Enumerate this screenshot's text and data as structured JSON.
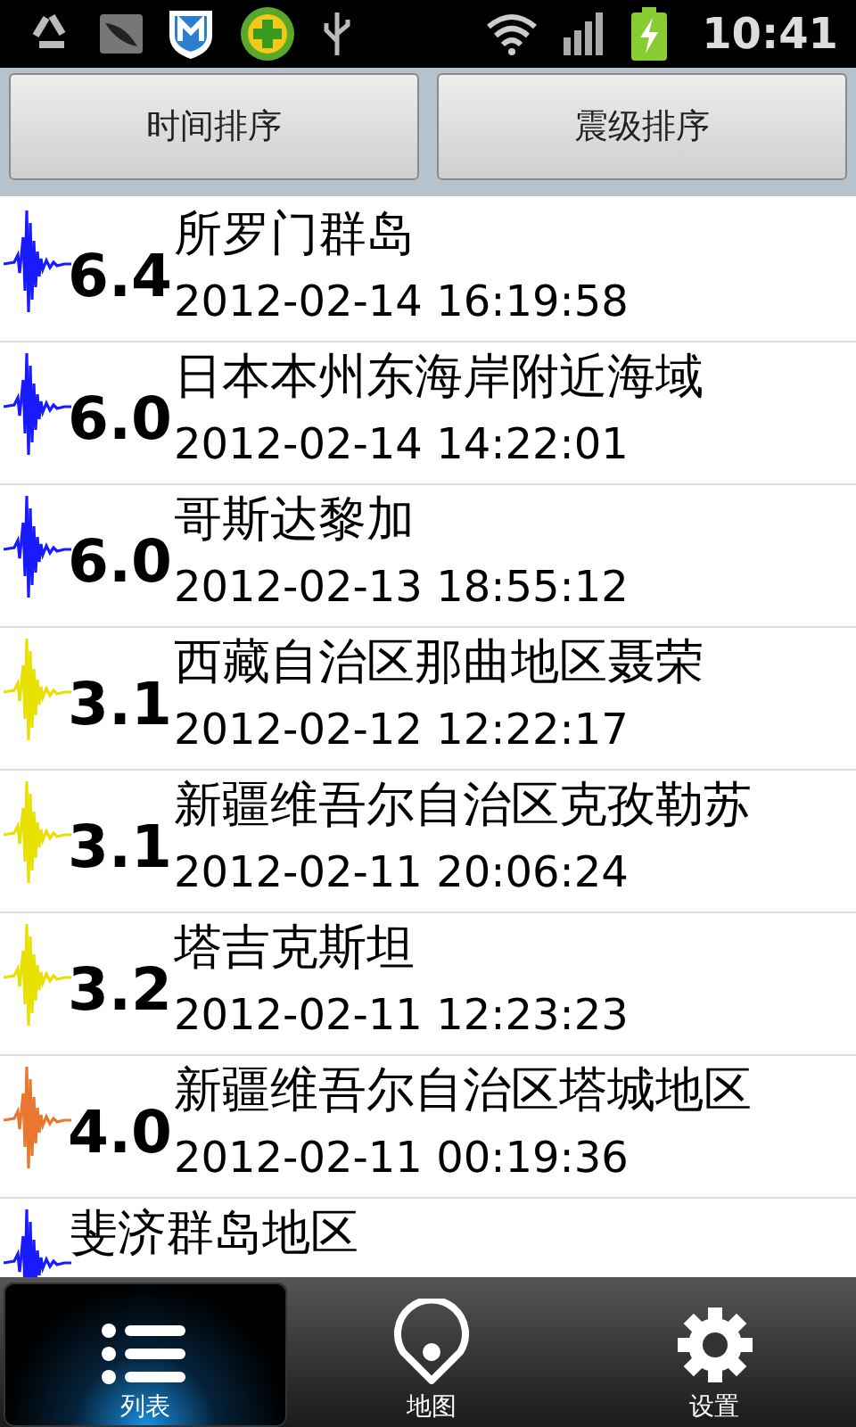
{
  "status_bar": {
    "time": "10:41"
  },
  "sort_buttons": [
    "时间排序",
    "震级排序"
  ],
  "quakes": [
    {
      "magnitude": "6.4",
      "place": "所罗门群岛",
      "time": "2012-02-14 16:19:58",
      "color": "#1a1aff"
    },
    {
      "magnitude": "6.0",
      "place": "日本本州东海岸附近海域",
      "time": "2012-02-14 14:22:01",
      "color": "#1a1aff"
    },
    {
      "magnitude": "6.0",
      "place": "哥斯达黎加",
      "time": "2012-02-13 18:55:12",
      "color": "#1a1aff"
    },
    {
      "magnitude": "3.1",
      "place": "西藏自治区那曲地区聂荣",
      "time": "2012-02-12 12:22:17",
      "color": "#e8e000"
    },
    {
      "magnitude": "3.1",
      "place": "新疆维吾尔自治区克孜勒苏",
      "time": "2012-02-11 20:06:24",
      "color": "#e8e000"
    },
    {
      "magnitude": "3.2",
      "place": "塔吉克斯坦",
      "time": "2012-02-11 12:23:23",
      "color": "#e8e000"
    },
    {
      "magnitude": "4.0",
      "place": "新疆维吾尔自治区塔城地区",
      "time": "2012-02-11 00:19:36",
      "color": "#e87830"
    },
    {
      "place": "斐济群岛地区",
      "color": "#1a1aff"
    }
  ],
  "tabs": [
    {
      "label": "列表",
      "kind": "list",
      "selected": true
    },
    {
      "label": "地图",
      "kind": "map",
      "selected": false
    },
    {
      "label": "设置",
      "kind": "settings",
      "selected": false
    }
  ]
}
